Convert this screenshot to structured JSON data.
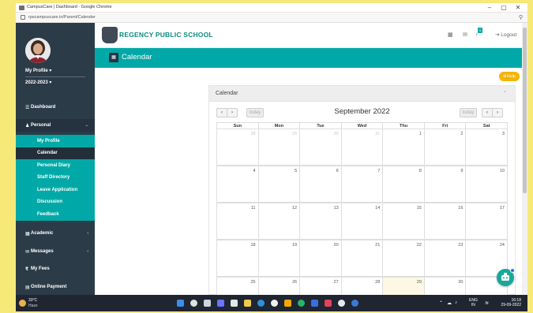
{
  "browser": {
    "window_title": "CampusCare | Dashboard - Google Chrome",
    "url": "rpscampuscare.in/Parent/Calender",
    "controls": {
      "minimize": "–",
      "maximize": "▢",
      "close": "✕"
    }
  },
  "header": {
    "school_name": "REGENCY PUBLIC SCHOOL",
    "notification_count": "1",
    "logout_label": "Logout",
    "accent_color": "#00a9a7"
  },
  "sidebar": {
    "profile_label": "My Profile",
    "session_label": "2022-2023",
    "items": [
      {
        "label": "Dashboard",
        "icon": "dashboard-icon"
      },
      {
        "label": "Personal",
        "icon": "user-icon",
        "expanded": true
      },
      {
        "label": "Academic",
        "icon": "academic-icon"
      },
      {
        "label": "Messages",
        "icon": "envelope-icon"
      },
      {
        "label": "My Fees",
        "icon": "rupee-icon"
      },
      {
        "label": "Online Payment",
        "icon": "payment-icon"
      }
    ],
    "personal_submenu": [
      {
        "label": "My Profile"
      },
      {
        "label": "Calendar",
        "active": true
      },
      {
        "label": "Personal Diary"
      },
      {
        "label": "Staff Directory"
      },
      {
        "label": "Leave Application"
      },
      {
        "label": "Discussion"
      },
      {
        "label": "Feedback"
      }
    ]
  },
  "page": {
    "title": "Calendar",
    "help_label": "Help",
    "panel_title": "Calendar"
  },
  "calendar": {
    "month_title": "September 2022",
    "today_label": "today",
    "weekdays": [
      "Sun",
      "Mon",
      "Tue",
      "Wed",
      "Thu",
      "Fri",
      "Sat"
    ],
    "weeks": [
      [
        "28",
        "29",
        "30",
        "31",
        "1",
        "2",
        "3"
      ],
      [
        "4",
        "5",
        "6",
        "7",
        "8",
        "9",
        "10"
      ],
      [
        "11",
        "12",
        "13",
        "14",
        "15",
        "16",
        "17"
      ],
      [
        "18",
        "19",
        "20",
        "21",
        "22",
        "23",
        "24"
      ],
      [
        "25",
        "26",
        "27",
        "28",
        "29",
        "30",
        "1"
      ]
    ],
    "other_month_cells": [
      [
        0,
        0
      ],
      [
        0,
        1
      ],
      [
        0,
        2
      ],
      [
        0,
        3
      ],
      [
        4,
        6
      ]
    ],
    "today_cell": [
      4,
      4
    ]
  },
  "taskbar": {
    "temperature": "33°C",
    "weather": "Haze",
    "language": "ENG",
    "region": "IN",
    "time": "16:18",
    "date": "29-09-2022"
  }
}
